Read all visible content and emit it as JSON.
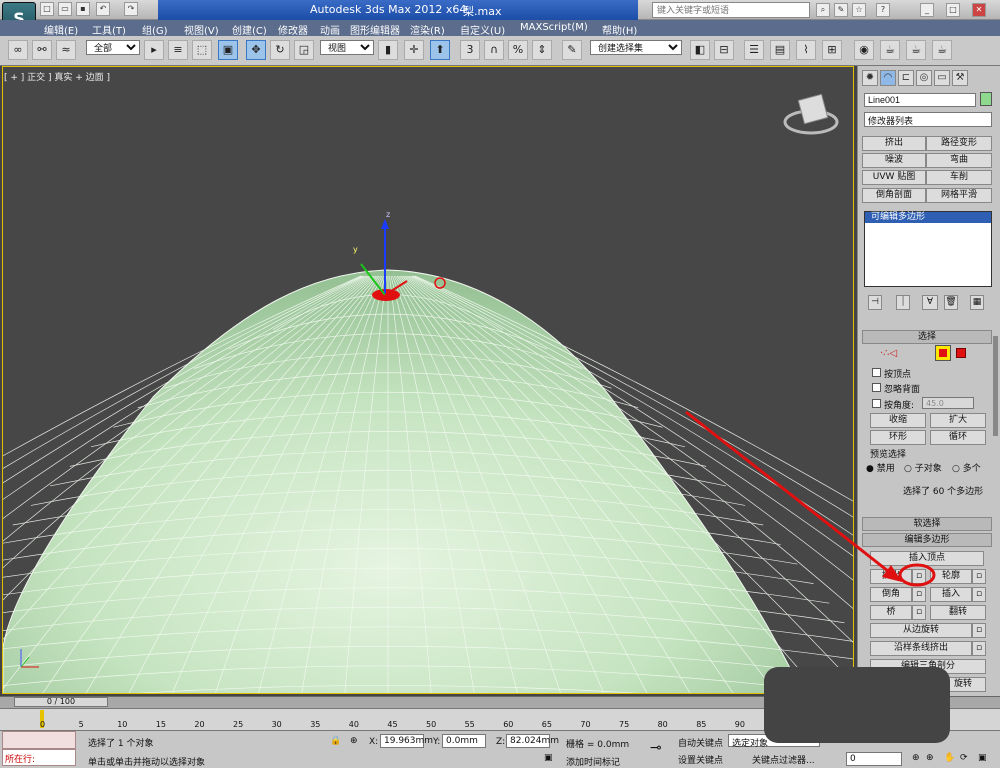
{
  "title": {
    "app": "Autodesk 3ds Max  2012 x64",
    "file": "梨.max",
    "search_placeholder": "键入关键字或短语"
  },
  "menu": [
    "编辑(E)",
    "工具(T)",
    "组(G)",
    "视图(V)",
    "创建(C)",
    "修改器",
    "动画",
    "图形编辑器",
    "渲染(R)",
    "自定义(U)",
    "MAXScript(M)",
    "帮助(H)"
  ],
  "toolbar": {
    "filter_value": "全部",
    "view_value": "视图",
    "snap_labels": [
      "3",
      "%"
    ],
    "selection_set_placeholder": "创建选择集"
  },
  "viewport": {
    "label": "[ + ] 正交 ] 真实 + 边面 ]",
    "axis_x": "x",
    "axis_y": "y",
    "axis_z": "z"
  },
  "panel": {
    "object_name": "Line001",
    "object_color": "#8fd98f",
    "modifier_list": "修改器列表",
    "modifier_buttons": [
      {
        "left": "挤出",
        "right": "路径变形"
      },
      {
        "left": "噪波",
        "right": "弯曲"
      },
      {
        "left": "UVW 贴图",
        "right": "车削"
      },
      {
        "left": "倒角剖面",
        "right": "网格平滑"
      }
    ],
    "stack_item": "可编辑多边形",
    "selection": {
      "header": "选择",
      "by_vertex": "按顶点",
      "ignore_back": "忽略背面",
      "by_angle": "按角度:",
      "angle_value": "45.0",
      "shrink": "收缩",
      "grow": "扩大",
      "ring": "环形",
      "loop": "循环",
      "preview_header": "预览选择",
      "preview_options": [
        "禁用",
        "子对象",
        "多个"
      ],
      "status": "选择了 60 个多边形"
    },
    "soft_selection": "软选择",
    "edit_polygons": {
      "header": "编辑多边形",
      "insert_vertex": "插入顶点",
      "extrude": "挤出",
      "outline": "轮廓",
      "bevel": "倒角",
      "inset": "插入",
      "bridge": "桥",
      "flip": "翻转",
      "hinge": "从边旋转",
      "extrude_spline": "沿样条线挤出",
      "edit_tri": "编辑三角剖分",
      "turn": "旋转"
    }
  },
  "timeline": {
    "slider": "0 / 100",
    "ticks": [
      "0",
      "5",
      "10",
      "15",
      "20",
      "25",
      "30",
      "35",
      "40",
      "45",
      "50",
      "55",
      "60",
      "65",
      "70",
      "75",
      "80",
      "85",
      "90"
    ]
  },
  "status": {
    "running": "所在行:",
    "selected": "选择了 1 个对象",
    "hint": "单击或单击并拖动以选择对象",
    "x_label": "X:",
    "x_value": "19.963mm",
    "y_label": "Y:",
    "y_value": "0.0mm",
    "z_label": "Z:",
    "z_value": "82.024mm",
    "grid": "栅格 = 0.0mm",
    "auto_key": "自动关键点",
    "set_key": "设置关键点",
    "selected_obj": "选定对象",
    "key_filters": "关键点过滤器...",
    "add_time_tag": "添加时间标记",
    "frame_value": "0"
  },
  "colors": {
    "accent": "#3b78c4",
    "annotation": "#e01010",
    "mesh": "#bfe2bf"
  }
}
